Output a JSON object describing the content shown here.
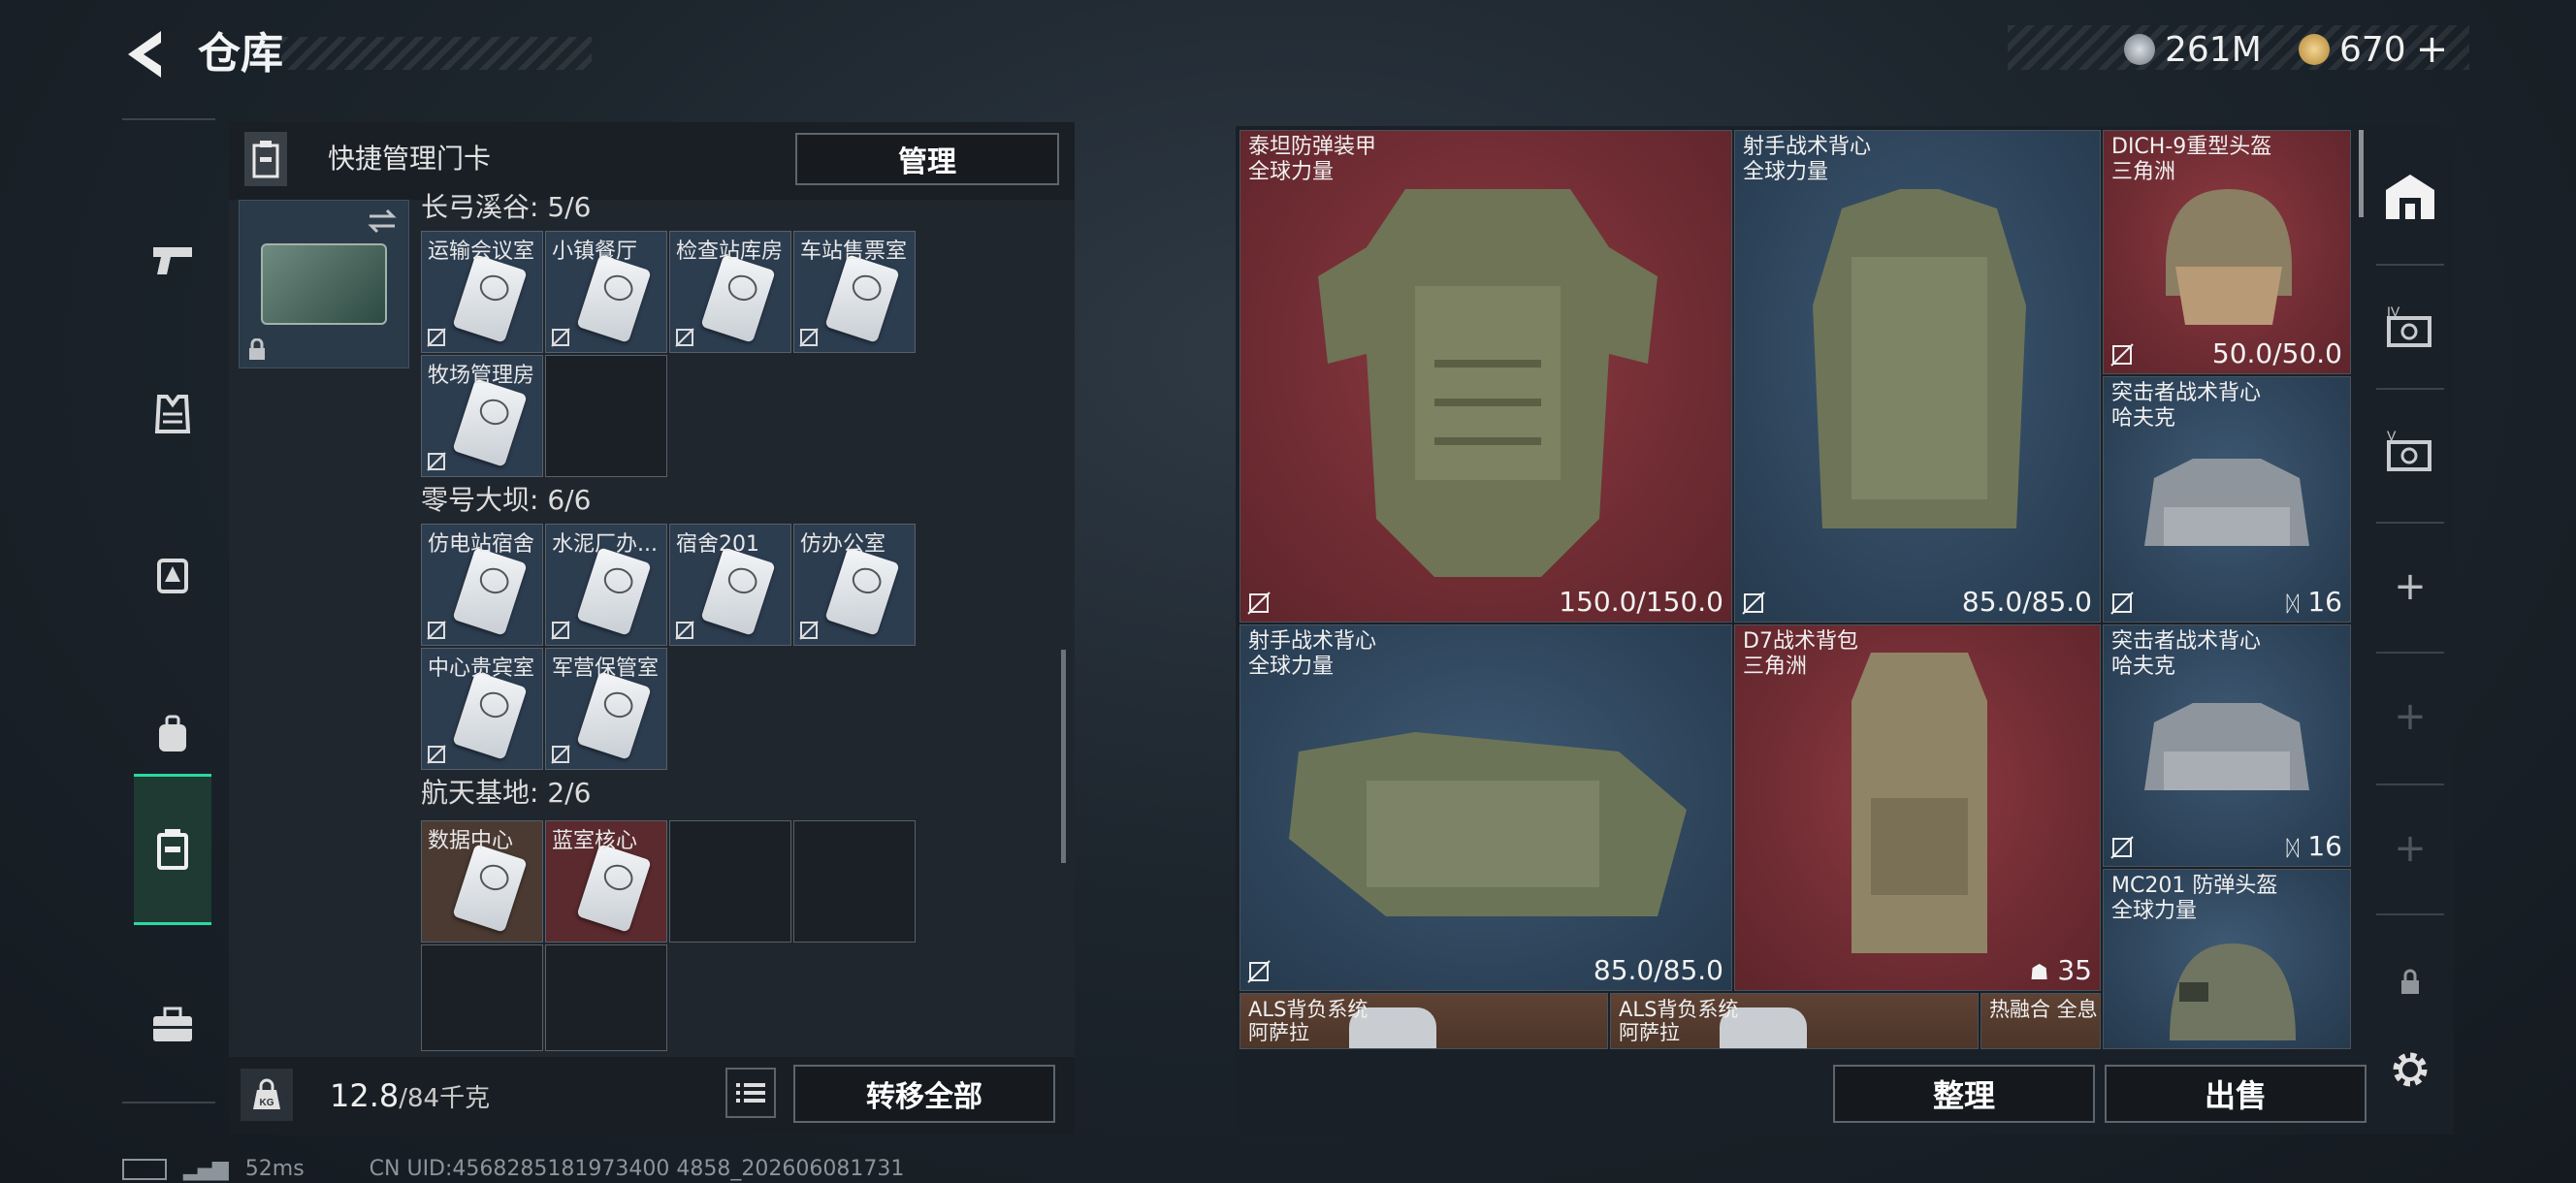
{
  "header": {
    "title": "仓库",
    "currency": [
      {
        "icon": "silver-coin-icon",
        "value": "261M",
        "color": "#a8b0b8"
      },
      {
        "icon": "gold-coin-icon",
        "value": "670",
        "color": "#d9b46a",
        "plus": "+"
      }
    ]
  },
  "nav": {
    "items": [
      {
        "name": "weapons",
        "icon": "pistol-icon",
        "active": false
      },
      {
        "name": "armor",
        "icon": "vest-icon",
        "active": false
      },
      {
        "name": "rig",
        "icon": "chest-rig-icon",
        "active": false
      },
      {
        "name": "backpack",
        "icon": "backpack-icon",
        "active": false
      },
      {
        "name": "keycard",
        "icon": "keycard-case-icon",
        "active": true
      },
      {
        "name": "toolbox",
        "icon": "toolbox-icon",
        "active": false
      }
    ]
  },
  "left_panel": {
    "quick_label": "快捷管理门卡",
    "manage_label": "管理",
    "groups": [
      {
        "title": "长弓溪谷: 5/6",
        "slots": [
          {
            "label": "运输会议室",
            "tone": "blue"
          },
          {
            "label": "小镇餐厅",
            "tone": "blue"
          },
          {
            "label": "检查站库房",
            "tone": "blue"
          },
          {
            "label": "车站售票室",
            "tone": "blue"
          },
          {
            "label": "牧场管理房",
            "tone": "blue"
          }
        ]
      },
      {
        "title": "零号大坝: 6/6",
        "slots": [
          {
            "label": "仿电站宿舍",
            "tone": "blue"
          },
          {
            "label": "水泥厂办...",
            "tone": "blue"
          },
          {
            "label": "宿舍201",
            "tone": "blue"
          },
          {
            "label": "仿办公室",
            "tone": "blue"
          },
          {
            "label": "中心贵宾室",
            "tone": "blue"
          },
          {
            "label": "军营保管室",
            "tone": "blue"
          }
        ]
      },
      {
        "title": "航天基地: 2/6",
        "slots": [
          {
            "label": "数据中心",
            "tone": "brown"
          },
          {
            "label": "蓝室核心",
            "tone": "red"
          }
        ]
      }
    ],
    "weight_value": "12.8",
    "weight_max": "/84千克",
    "weight_badge": "KG",
    "transfer_label": "转移全部"
  },
  "right_panel": {
    "items": [
      {
        "name": "泰坦防弹装甲",
        "sub": "全球力量",
        "value": "150.0/150.0",
        "tone": "red"
      },
      {
        "name": "射手战术背心",
        "sub": "全球力量",
        "value": "85.0/85.0",
        "tone": "blue"
      },
      {
        "name": "DICH-9重型头盔",
        "sub": "三角洲",
        "value": "50.0/50.0",
        "tone": "red"
      },
      {
        "name": "突击者战术背心",
        "sub": "哈夫克",
        "value": "16",
        "tone": "blue"
      },
      {
        "name": "射手战术背心",
        "sub": "全球力量",
        "value": "85.0/85.0",
        "tone": "blue"
      },
      {
        "name": "D7战术背包",
        "sub": "三角洲",
        "value": "35",
        "tone": "red"
      },
      {
        "name": "突击者战术背心",
        "sub": "哈夫克",
        "value": "16",
        "tone": "blue"
      },
      {
        "name": "MC201 防弹头盔",
        "sub": "全球力量",
        "value": "",
        "tone": "blue"
      },
      {
        "name": "ALS背负系统",
        "sub": "阿萨拉",
        "value": "",
        "tone": "brown"
      },
      {
        "name": "ALS背负系统",
        "sub": "阿萨拉",
        "value": "",
        "tone": "brown"
      },
      {
        "name": "热融合 全息",
        "sub": "",
        "value": "",
        "tone": "brown"
      }
    ],
    "sort_label": "整理",
    "sell_label": "出售"
  },
  "side_tabs": [
    {
      "icon": "storage-icon"
    },
    {
      "icon": "level-iv-storage-icon",
      "label": "IV"
    },
    {
      "icon": "level-v-storage-icon",
      "label": "V"
    },
    {
      "icon": "add-icon",
      "label": "+"
    },
    {
      "icon": "add-icon",
      "label": "+"
    },
    {
      "icon": "add-icon",
      "label": "+"
    },
    {
      "icon": "lock-icon"
    }
  ],
  "footer": {
    "ping": "52ms",
    "uid": "CN UID:4568285181973400 4858_202606081731"
  }
}
